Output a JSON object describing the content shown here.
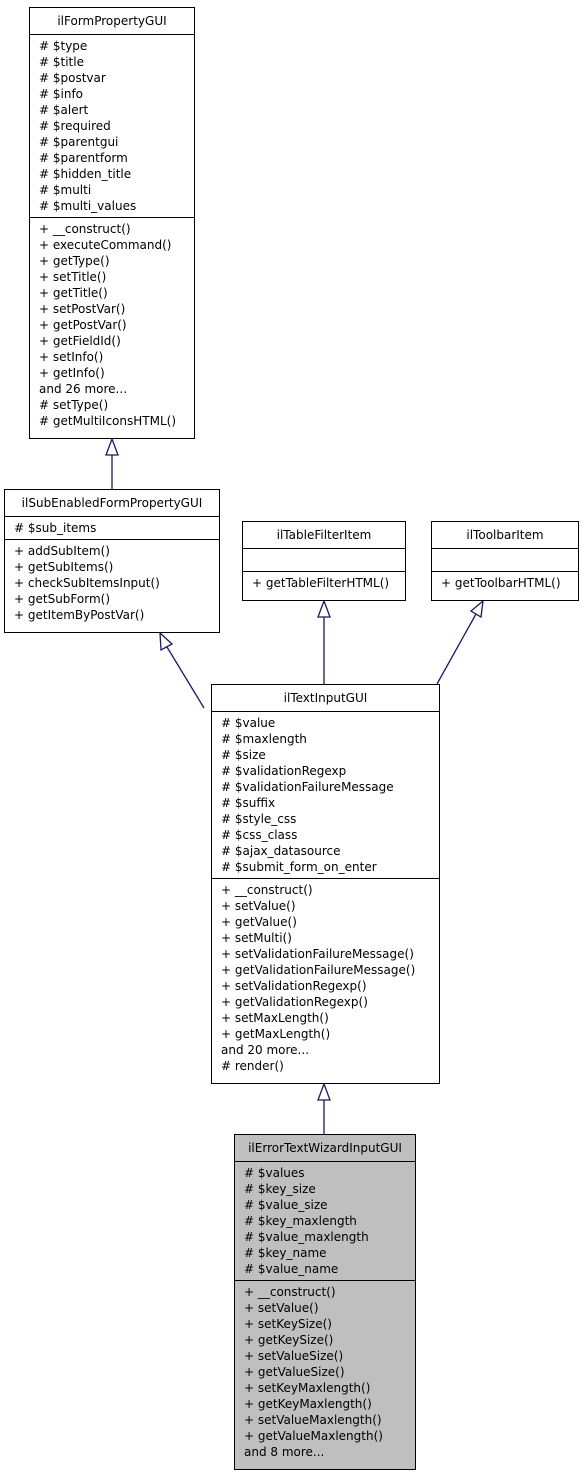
{
  "diagram": {
    "type": "class-inheritance",
    "edge_color": "#191970",
    "focus_fill": "#bfbfbf",
    "classes": [
      {
        "id": "ilFormPropertyGUI",
        "name": "ilFormPropertyGUI",
        "attributes": [
          "# $type",
          "# $title",
          "# $postvar",
          "# $info",
          "# $alert",
          "# $required",
          "# $parentgui",
          "# $parentform",
          "# $hidden_title",
          "# $multi",
          "# $multi_values"
        ],
        "methods": [
          "+ __construct()",
          "+ executeCommand()",
          "+ getType()",
          "+ setTitle()",
          "+ getTitle()",
          "+ setPostVar()",
          "+ getPostVar()",
          "+ getFieldId()",
          "+ setInfo()",
          "+ getInfo()",
          "and 26 more...",
          "# setType()",
          "# getMultiIconsHTML()"
        ]
      },
      {
        "id": "ilSubEnabledFormPropertyGUI",
        "name": "ilSubEnabledFormPropertyGUI",
        "attributes": [
          "# $sub_items"
        ],
        "methods": [
          "+ addSubItem()",
          "+ getSubItems()",
          "+ checkSubItemsInput()",
          "+ getSubForm()",
          "+ getItemByPostVar()"
        ]
      },
      {
        "id": "ilTableFilterItem",
        "name": "ilTableFilterItem",
        "attributes": [],
        "methods": [
          "+ getTableFilterHTML()"
        ]
      },
      {
        "id": "ilToolbarItem",
        "name": "ilToolbarItem",
        "attributes": [],
        "methods": [
          "+ getToolbarHTML()"
        ]
      },
      {
        "id": "ilTextInputGUI",
        "name": "ilTextInputGUI",
        "attributes": [
          "# $value",
          "# $maxlength",
          "# $size",
          "# $validationRegexp",
          "# $validationFailureMessage",
          "# $suffix",
          "# $style_css",
          "# $css_class",
          "# $ajax_datasource",
          "# $submit_form_on_enter"
        ],
        "methods": [
          "+ __construct()",
          "+ setValue()",
          "+ getValue()",
          "+ setMulti()",
          "+ setValidationFailureMessage()",
          "+ getValidationFailureMessage()",
          "+ setValidationRegexp()",
          "+ getValidationRegexp()",
          "+ setMaxLength()",
          "+ getMaxLength()",
          "and 20 more...",
          "# render()"
        ]
      },
      {
        "id": "ilErrorTextWizardInputGUI",
        "name": "ilErrorTextWizardInputGUI",
        "focus": true,
        "attributes": [
          "# $values",
          "# $key_size",
          "# $value_size",
          "# $key_maxlength",
          "# $value_maxlength",
          "# $key_name",
          "# $value_name"
        ],
        "methods": [
          "+ __construct()",
          "+ setValue()",
          "+ setKeySize()",
          "+ getKeySize()",
          "+ setValueSize()",
          "+ getValueSize()",
          "+ setKeyMaxlength()",
          "+ getKeyMaxlength()",
          "+ setValueMaxlength()",
          "+ getValueMaxlength()",
          "and 8 more..."
        ]
      }
    ],
    "edges": [
      {
        "from": "ilSubEnabledFormPropertyGUI",
        "to": "ilFormPropertyGUI",
        "kind": "inherits"
      },
      {
        "from": "ilTextInputGUI",
        "to": "ilSubEnabledFormPropertyGUI",
        "kind": "inherits"
      },
      {
        "from": "ilTextInputGUI",
        "to": "ilTableFilterItem",
        "kind": "inherits"
      },
      {
        "from": "ilTextInputGUI",
        "to": "ilToolbarItem",
        "kind": "inherits"
      },
      {
        "from": "ilErrorTextWizardInputGUI",
        "to": "ilTextInputGUI",
        "kind": "inherits"
      }
    ]
  }
}
